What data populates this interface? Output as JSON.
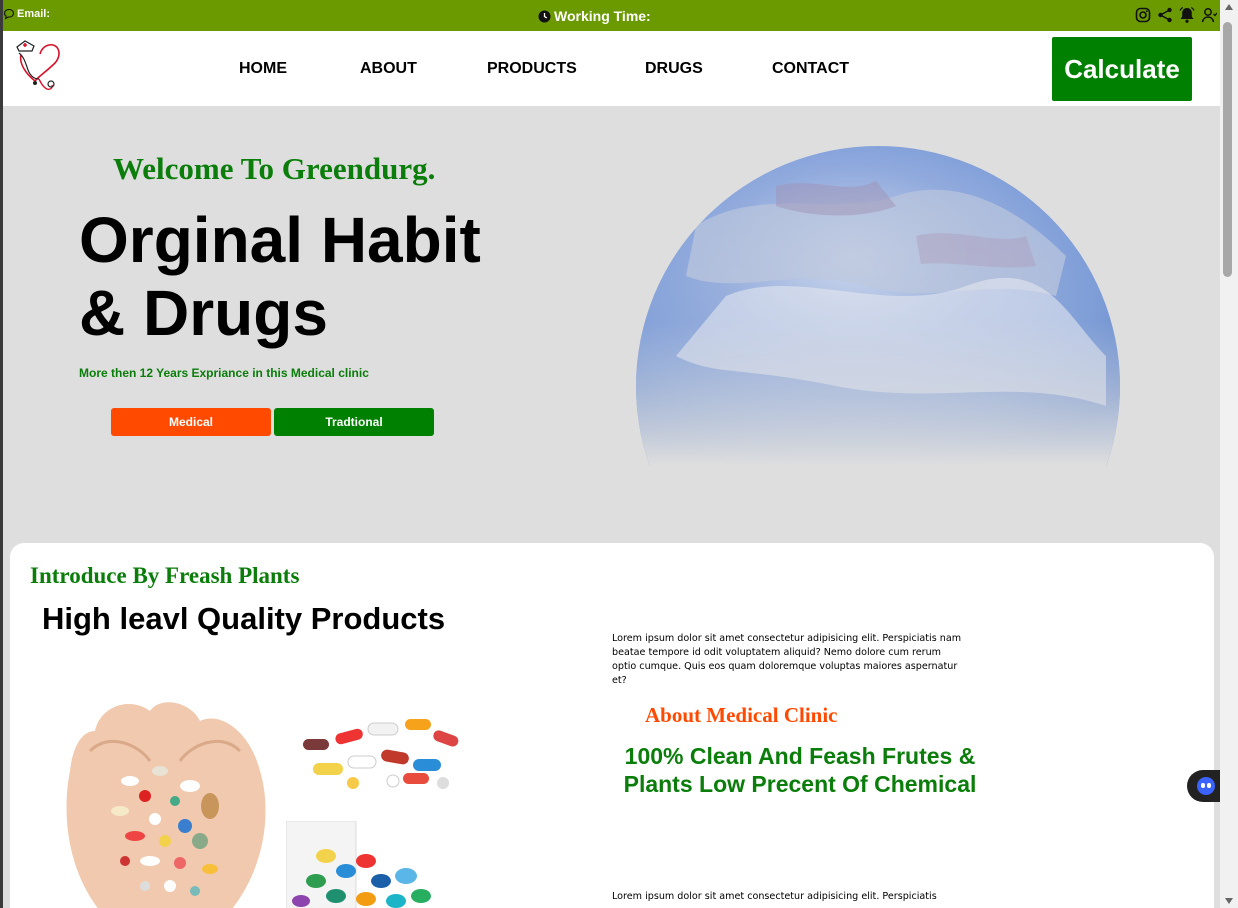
{
  "topbar": {
    "email_label": "Email:",
    "working_label": "Working Time:",
    "icons": [
      "instagram-icon",
      "share-icon",
      "bell-icon",
      "user-icon"
    ]
  },
  "nav": {
    "items": [
      "HOME",
      "ABOUT",
      "PRODUCTS",
      "DRUGS",
      "CONTACT"
    ],
    "cta": "Calculate"
  },
  "hero": {
    "welcome": "Welcome To Greendurg.",
    "headline_line1": "Orginal Habit",
    "headline_line2": "& Drugs",
    "experience": "More then 12 Years Expriance in this Medical clinic",
    "button_medical": "Medical",
    "button_traditional": "Tradtional"
  },
  "section": {
    "intro": "Introduce By Freash Plants",
    "title": "High leavl Quality Products",
    "lorem1": "Lorem ipsum dolor sit amet consectetur adipisicing elit. Perspiciatis nam beatae tempore id odit voluptatem aliquid? Nemo dolore cum rerum optio cumque. Quis eos quam doloremque voluptas maiores aspernatur et?",
    "about": "About Medical Clinic",
    "clean": "100% Clean And Feash Frutes & Plants Low Precent Of Chemical",
    "lorem2": "Lorem ipsum dolor sit amet consectetur adipisicing elit. Perspiciatis"
  },
  "colors": {
    "topbar": "#6b9a00",
    "brand_green": "#008000",
    "accent_orange": "#ff4a00"
  }
}
